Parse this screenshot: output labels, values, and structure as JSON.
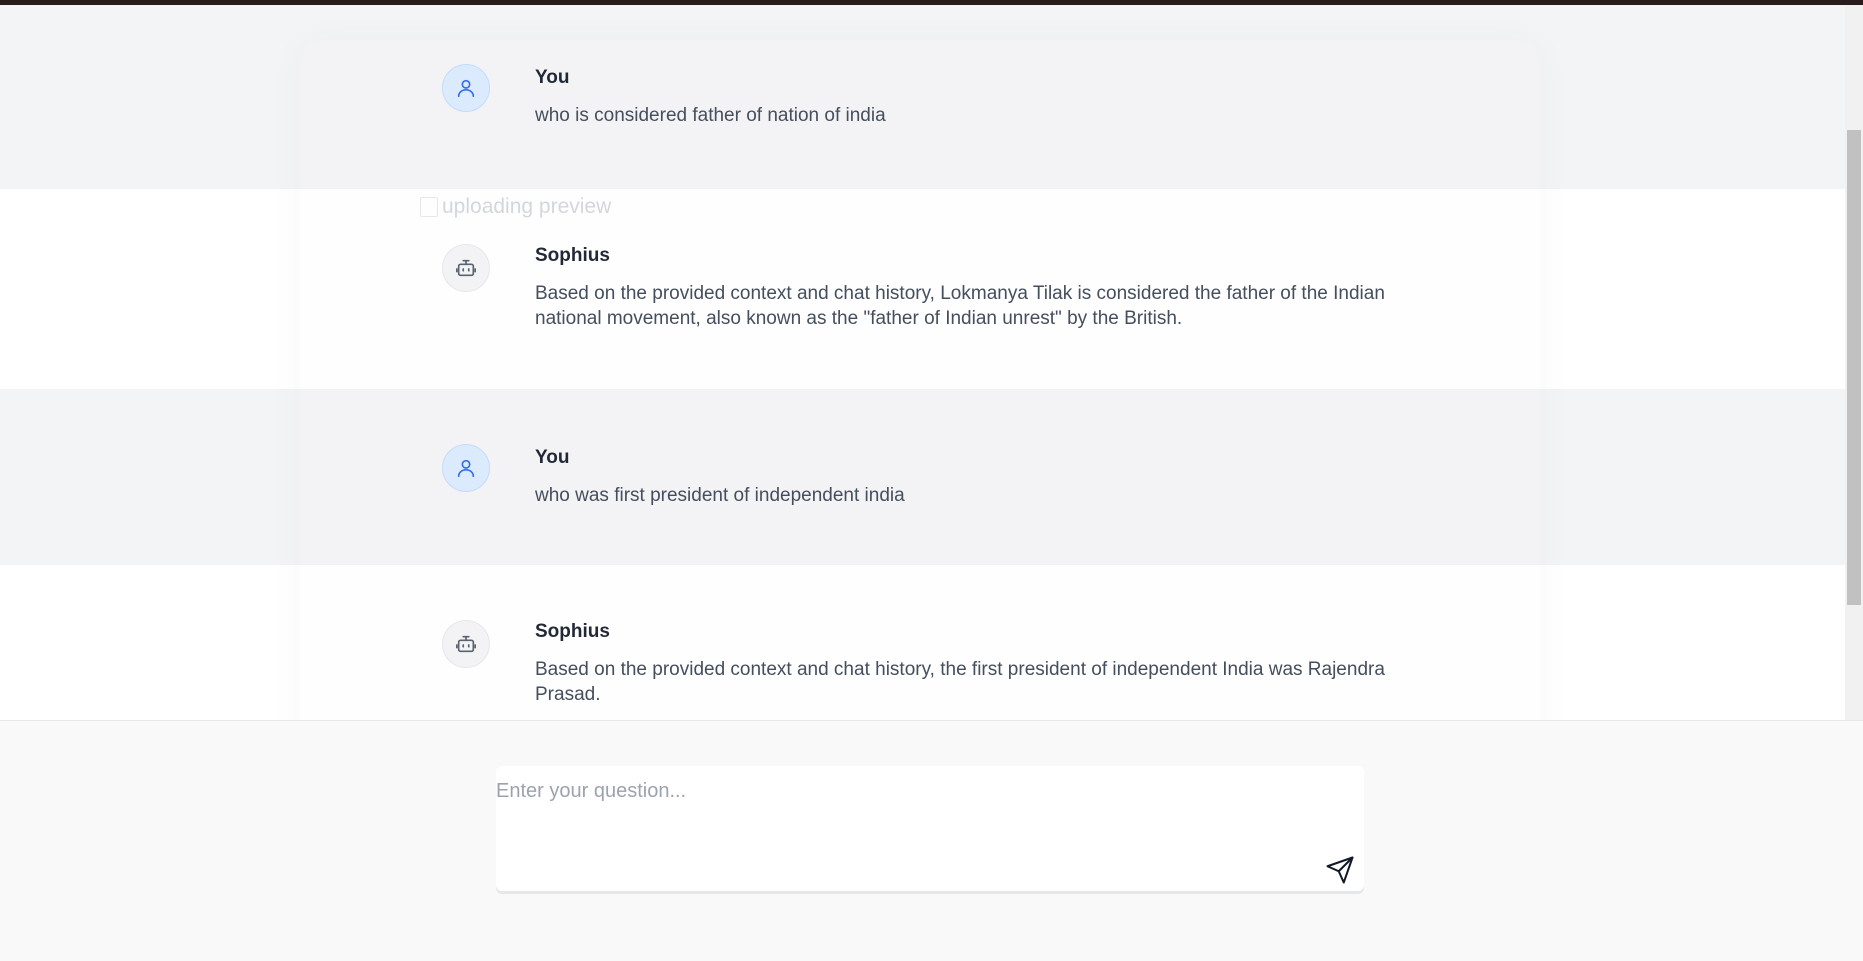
{
  "messages": [
    {
      "role": "user",
      "sender": "You",
      "text": "who is considered father of nation of india"
    },
    {
      "role": "bot",
      "sender": "Sophius",
      "text": "Based on the provided context and chat history, Lokmanya Tilak is considered the father of the Indian national movement, also known as the \"father of Indian unrest\" by the British."
    },
    {
      "role": "user",
      "sender": "You",
      "text": "who was first president of independent india"
    },
    {
      "role": "bot",
      "sender": "Sophius",
      "text": "Based on the provided context and chat history, the first president of independent India was Rajendra Prasad."
    }
  ],
  "upload_preview": {
    "alt_text": "uploading preview"
  },
  "composer": {
    "placeholder": "Enter your question...",
    "value": "",
    "send_icon": "send-icon"
  },
  "icons": {
    "user_avatar": "user-icon",
    "bot_avatar": "robot-icon"
  },
  "colors": {
    "user_row_bg": "#f3f4f6",
    "bot_row_bg": "#ffffff",
    "user_avatar_bg": "#dbeafe",
    "user_icon": "#2563eb",
    "bot_icon": "#4b5563"
  }
}
